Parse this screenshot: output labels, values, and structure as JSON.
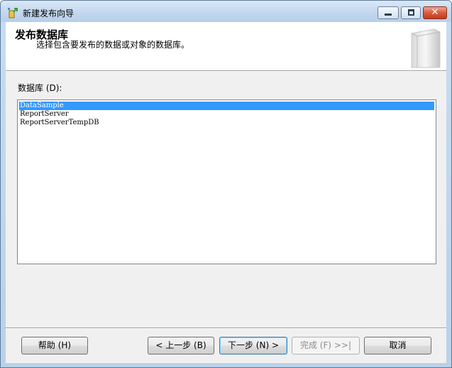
{
  "window": {
    "title": "新建发布向导",
    "controls": {
      "minimize": "minimize-icon",
      "maximize": "maximize-icon",
      "close": "close-icon"
    }
  },
  "header": {
    "title": "发布数据库",
    "subtitle": "选择包含要发布的数据或对象的数据库。"
  },
  "databases": {
    "label": "数据库 (D):",
    "items": [
      "DataSample",
      "ReportServer",
      "ReportServerTempDB"
    ],
    "selected_index": 0
  },
  "buttons": {
    "help": "帮助 (H)",
    "back": "< 上一步 (B)",
    "next": "下一步 (N) >",
    "finish": "完成 (F) >>|",
    "cancel": "取消"
  },
  "colors": {
    "selection": "#3399ff",
    "close_button": "#c33b1c"
  }
}
